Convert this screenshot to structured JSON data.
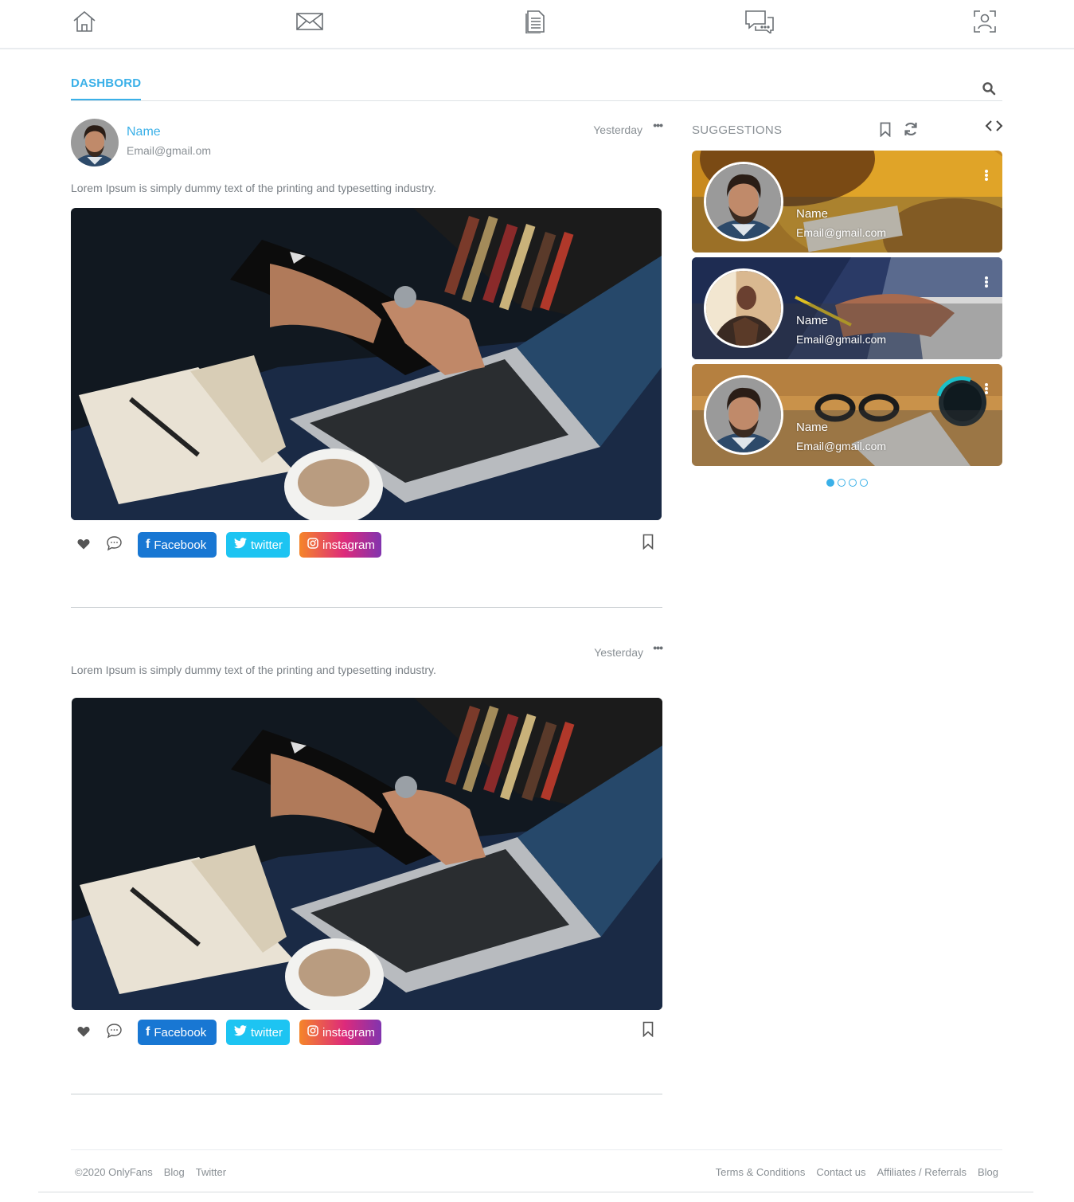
{
  "nav": {
    "icons": [
      "home-icon",
      "mail-icon",
      "document-icon",
      "chat-icon",
      "profile-scan-icon"
    ]
  },
  "tabs": {
    "dashboard": "DASHBORD"
  },
  "posts": [
    {
      "user_name": "Name",
      "user_email": "Email@gmail.om",
      "time": "Yesterday",
      "more": "•••",
      "text": "Lorem Ipsum is simply dummy text of the printing and typesetting industry.",
      "share": {
        "facebook": "Facebook",
        "twitter": "twitter",
        "instagram": "instagram"
      }
    },
    {
      "time": "Yesterday",
      "more": "•••",
      "text": "Lorem Ipsum is simply dummy text of the printing and typesetting industry.",
      "share": {
        "facebook": "Facebook",
        "twitter": "twitter",
        "instagram": "instagram"
      }
    }
  ],
  "suggestions": {
    "title": "SUGGESTIONS",
    "cards": [
      {
        "name": "Name",
        "email": "Email@gmail.com"
      },
      {
        "name": "Name",
        "email": "Email@gmail.com"
      },
      {
        "name": "Name",
        "email": "Email@gmail.com"
      }
    ],
    "pager_pages": 4,
    "pager_active": 1
  },
  "footer": {
    "left": [
      "©2020 OnlyFans",
      "Blog",
      "Twitter"
    ],
    "right": [
      "Terms & Conditions",
      "Contact us",
      "Affiliates / Referrals",
      "Blog"
    ]
  },
  "colors": {
    "accent": "#3ab0e8",
    "facebook": "#1877d3",
    "twitter": "#1dc4f2",
    "instagram_start": "#f58529",
    "instagram_end": "#8134af"
  }
}
